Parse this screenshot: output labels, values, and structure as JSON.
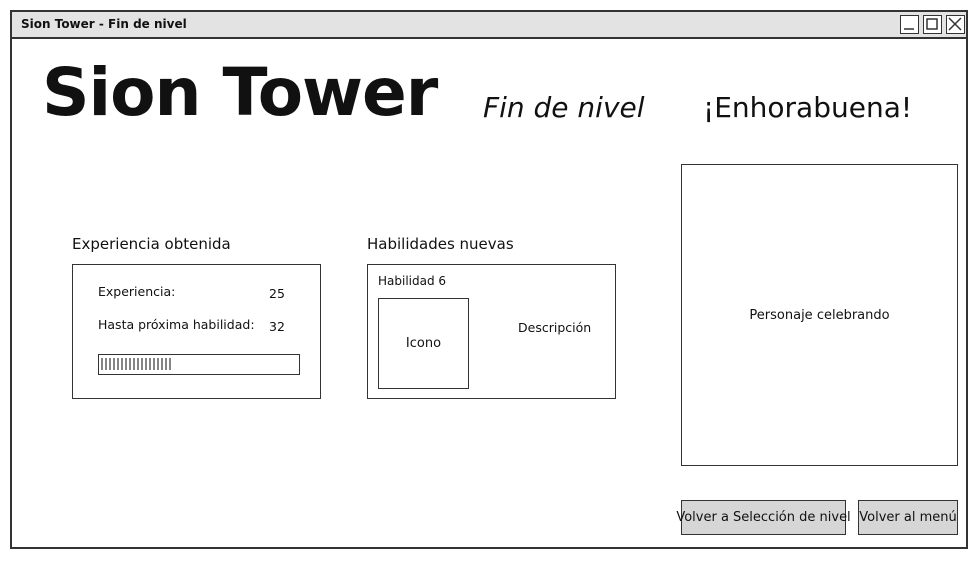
{
  "window": {
    "title": "Sion Tower - Fin de nivel"
  },
  "header": {
    "logo": "Sion Tower",
    "subtitle": "Fin de nivel",
    "congrats": "¡Enhorabuena!"
  },
  "experience": {
    "heading": "Experiencia obtenida",
    "exp_label": "Experiencia:",
    "exp_value": "25",
    "next_label": "Hasta próxima habilidad:",
    "next_value": "32",
    "progress_fraction": 0.36
  },
  "abilities": {
    "heading": "Habilidades nuevas",
    "name": "Habilidad 6",
    "icon_label": "Icono",
    "description": "Descripción"
  },
  "character": {
    "label": "Personaje celebrando"
  },
  "buttons": {
    "level_select": "Volver a Selección de nivel",
    "menu": "Volver al menú"
  }
}
